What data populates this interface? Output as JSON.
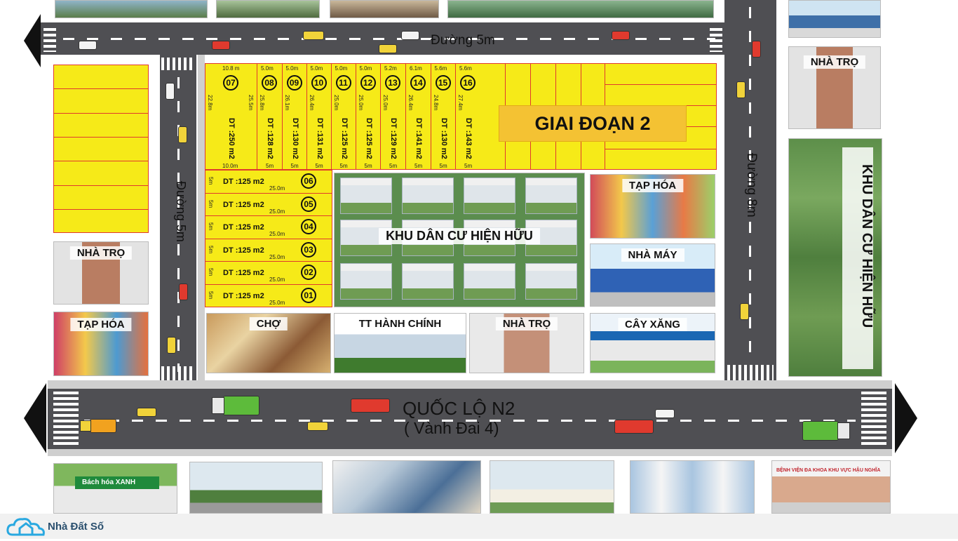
{
  "roads": {
    "top": "Đường 5m",
    "left": "Đường 5m",
    "right": "Đường 8m",
    "highway_line1": "QUỐC LỘ N2",
    "highway_line2": "( Vành Đai 4)"
  },
  "phase2": "GIAI ĐOẠN 2",
  "existing_center": "KHU DÂN CƯ HIỆN HỮU",
  "existing_right": "KHU DÂN CƯ HIỆN HỮU",
  "top_lots": [
    {
      "num": "07",
      "width": "10.8 m",
      "side": "22.8m",
      "side2": "25.5m",
      "area": "DT :250 m2",
      "bottom": "10.0m"
    },
    {
      "num": "08",
      "width": "5.0m",
      "side": "25.8m",
      "area": "DT :128 m2",
      "bottom": "5m"
    },
    {
      "num": "09",
      "width": "5.0m",
      "side": "26.1m",
      "area": "DT :130 m2",
      "bottom": "5m"
    },
    {
      "num": "10",
      "width": "5.0m",
      "side": "26.4m",
      "area": "DT :131 m2",
      "bottom": "5m"
    },
    {
      "num": "11",
      "width": "5.0m",
      "side": "25.0m",
      "area": "DT :125 m2",
      "bottom": "5m"
    },
    {
      "num": "12",
      "width": "5.0m",
      "side": "25.0m",
      "area": "DT :125 m2",
      "bottom": "5m"
    },
    {
      "num": "13",
      "width": "5.2m",
      "side": "25.0m",
      "area": "DT :129 m2",
      "bottom": "5m"
    },
    {
      "num": "14",
      "width": "6.1m",
      "side": "26.4m",
      "area": "DT :141 m2",
      "bottom": "5m"
    },
    {
      "num": "15",
      "width": "5.6m",
      "side": "24.8m",
      "area": "DT :130 m2",
      "bottom": "5m"
    },
    {
      "num": "16",
      "width": "5.6m",
      "side": "27.4m",
      "area": "DT :143 m2",
      "bottom": "5m"
    }
  ],
  "side_lots": [
    {
      "num": "06",
      "area": "DT :125 m2",
      "len": "25.0m",
      "w": "5m"
    },
    {
      "num": "05",
      "area": "DT :125 m2",
      "len": "25.0m",
      "w": "5m"
    },
    {
      "num": "04",
      "area": "DT :125 m2",
      "len": "25.0m",
      "w": "5m"
    },
    {
      "num": "03",
      "area": "DT :125 m2",
      "len": "25.0m",
      "w": "5m"
    },
    {
      "num": "02",
      "area": "DT :125 m2",
      "len": "25.0m",
      "w": "5m"
    },
    {
      "num": "01",
      "area": "DT :125 m2",
      "len": "25.0m",
      "w": "5m"
    }
  ],
  "places": {
    "nha_tro_left": "NHÀ TRỌ",
    "tap_hoa_left": "TẠP HÓA",
    "cho": "CHỢ",
    "tt_hanh_chinh": "TT HÀNH CHÍNH",
    "nha_tro_mid": "NHÀ TRỌ",
    "cay_xang": "CÂY XĂNG",
    "tap_hoa_right": "TẠP HÓA",
    "nha_may": "NHÀ MÁY",
    "nha_tro_right": "NHÀ TRỌ"
  },
  "bottom_signs": {
    "bach_hoa": "Bách hóa XANH",
    "benh_vien": "BỆNH VIỆN ĐA KHOA KHU VỰC HẬU NGHĨA"
  },
  "watermark": "Nhà Đất Số"
}
